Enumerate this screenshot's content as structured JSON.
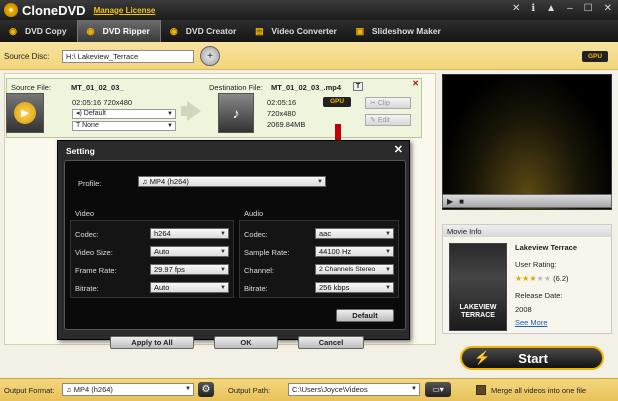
{
  "app": {
    "title": "CloneDVD",
    "manage_license": "Manage License"
  },
  "nav": {
    "tabs": [
      {
        "label": "DVD Copy",
        "icon": "disc-icon"
      },
      {
        "label": "DVD Ripper",
        "icon": "disc-icon",
        "active": true
      },
      {
        "label": "DVD Creator",
        "icon": "disc-icon"
      },
      {
        "label": "Video Converter",
        "icon": "film-icon"
      },
      {
        "label": "Slideshow Maker",
        "icon": "picture-icon"
      }
    ]
  },
  "source": {
    "label": "Source Disc:",
    "value": "H:\\ Lakeview_Terrace",
    "gpu": "GPU"
  },
  "file": {
    "source_label": "Source File:",
    "source_name": "MT_01_02_03_",
    "source_info": "02:05:16 720x480",
    "audio_track": "Default",
    "subtitle_track": "None",
    "dest_label": "Destination File:",
    "dest_name": "MT_01_02_03_.mp4",
    "dest_duration": "02:05:16",
    "dest_resolution": "720x480",
    "dest_size": "2069.84MB",
    "gpu": "GPU",
    "clip_label": "Clip",
    "edit_label": "Edit"
  },
  "dialog": {
    "title": "Setting",
    "profile_label": "Profile:",
    "profile_value": "MP4 (h264)",
    "video_heading": "Video",
    "audio_heading": "Audio",
    "video": {
      "codec_label": "Codec:",
      "codec": "h264",
      "size_label": "Video Size:",
      "size": "Auto",
      "framerate_label": "Frame Rate:",
      "framerate": "29.97 fps",
      "bitrate_label": "Bitrate:",
      "bitrate": "Auto"
    },
    "audio": {
      "codec_label": "Codec:",
      "codec": "aac",
      "samplerate_label": "Sample Rate:",
      "samplerate": "44100 Hz",
      "channel_label": "Channel:",
      "channel": "2 Channels Stereo",
      "bitrate_label": "Bitrate:",
      "bitrate": "256 kbps"
    },
    "default_btn": "Default",
    "apply_all_btn": "Apply to All",
    "ok_btn": "OK",
    "cancel_btn": "Cancel"
  },
  "movie": {
    "header": "Movie Info",
    "title": "Lakeview Terrace",
    "rating_label": "User Rating:",
    "rating": "(6.2)",
    "release_label": "Release Date:",
    "release": "2008",
    "see_more": "See More",
    "poster_text": "LAKEVIEW TERRACE",
    "stars_filled": 3
  },
  "start": {
    "label": "Start"
  },
  "bottom": {
    "format_label": "Output Format:",
    "format_value": "MP4 (h264)",
    "path_label": "Output Path:",
    "path_value": "C:\\Users\\Joyce\\Videos",
    "merge_label": "Merge all videos into one file"
  },
  "colors": {
    "accent": "#f0b400",
    "dialog_bg": "#2b2b2b",
    "arrow": "#c0000a"
  }
}
